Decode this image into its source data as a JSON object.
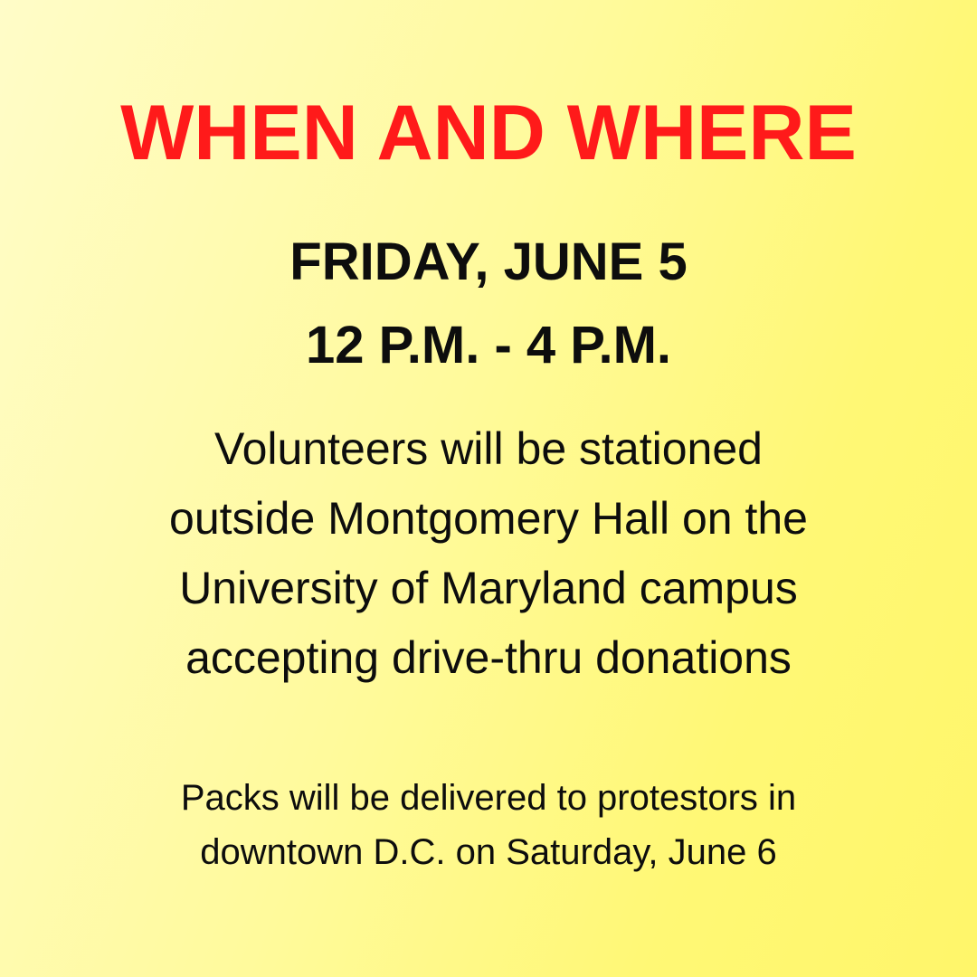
{
  "heading": "WHEN AND WHERE",
  "when": {
    "date": "FRIDAY, JUNE 5",
    "time": "12 P.M. - 4 P.M."
  },
  "where": {
    "lines": [
      "Volunteers will be stationed",
      "outside Montgomery Hall on the",
      "University of Maryland campus",
      "accepting drive-thru donations"
    ]
  },
  "delivery": {
    "lines": [
      "Packs will be delivered to protestors in",
      "downtown D.C. on Saturday, June 6"
    ]
  },
  "colors": {
    "heading": "#ff1a1a",
    "text": "#0d0d0d",
    "background_light": "#fffcc8",
    "background_bright": "#fff66a"
  }
}
